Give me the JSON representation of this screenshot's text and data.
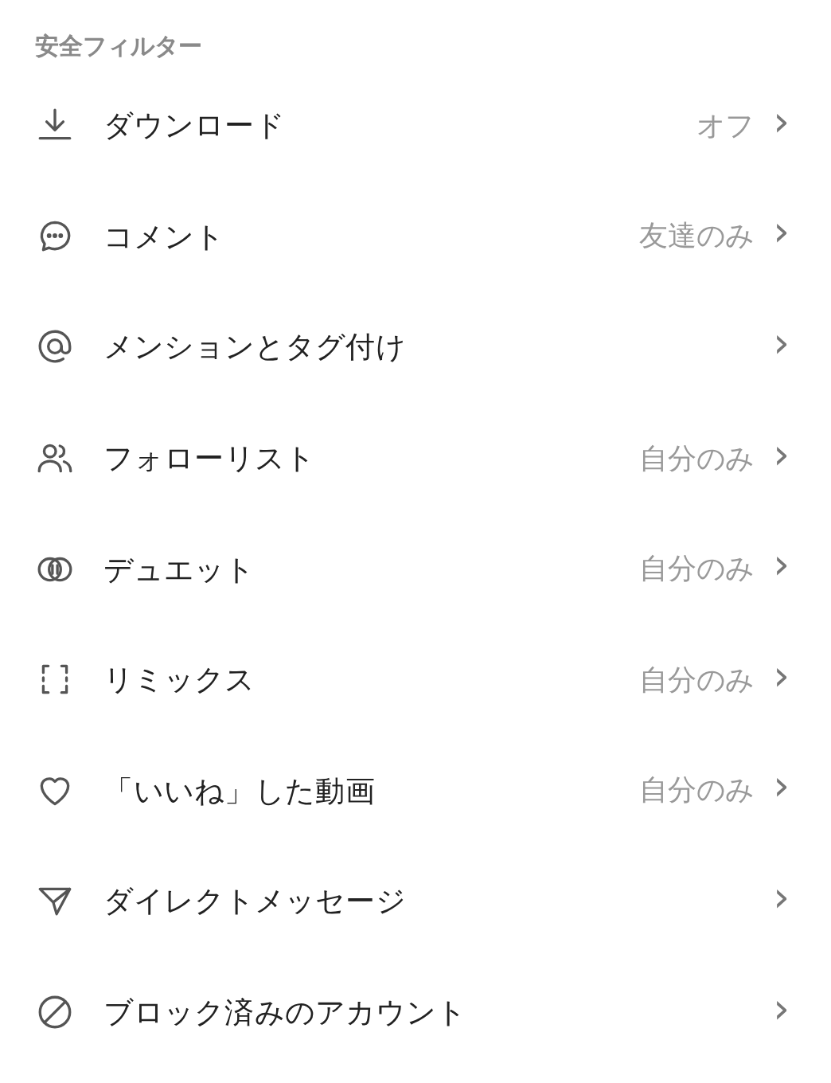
{
  "section_title": "安全フィルター",
  "items": [
    {
      "kind": "download",
      "label": "ダウンロード",
      "value": "オフ",
      "chevron": "›"
    },
    {
      "kind": "comment",
      "label": "コメント",
      "value": "友達のみ",
      "chevron": "›"
    },
    {
      "kind": "mention",
      "label": "メンションとタグ付け",
      "chevron": "›"
    },
    {
      "kind": "people",
      "label": "フォローリスト",
      "value": "自分のみ",
      "chevron": "›"
    },
    {
      "kind": "duet",
      "label": "デュエット",
      "value": "自分のみ",
      "chevron": "›"
    },
    {
      "kind": "remix",
      "label": "リミックス",
      "value": "自分のみ",
      "chevron": "›"
    },
    {
      "kind": "heart",
      "label": "「いいね」した動画",
      "value": "自分のみ",
      "chevron": "›"
    },
    {
      "kind": "send",
      "label": "ダイレクトメッセージ",
      "chevron": "›"
    },
    {
      "kind": "block",
      "label": "ブロック済みのアカウント",
      "chevron": "›"
    }
  ]
}
